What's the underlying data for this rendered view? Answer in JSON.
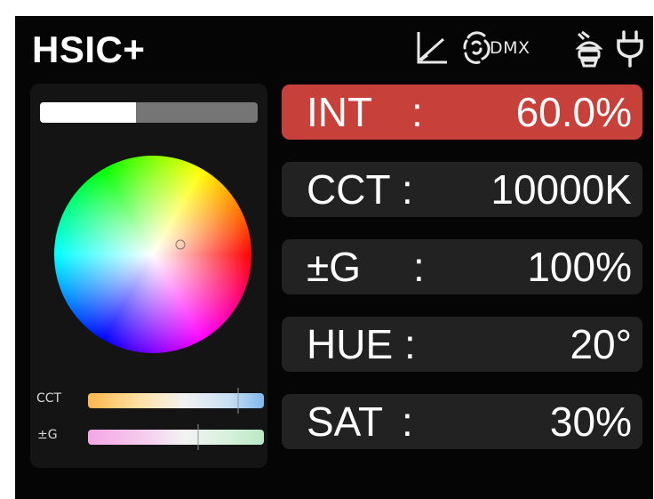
{
  "header": {
    "title": "HSIC+",
    "icons": [
      "curve-icon",
      "dmx-icon",
      "fan-icon",
      "power-plug-icon"
    ],
    "dmx_label": "DMX"
  },
  "intensity_bar": {
    "level": 0.44
  },
  "color_wheel": {
    "marker": {
      "hue_deg": 20,
      "saturation": 0.3
    }
  },
  "sliders": {
    "cct": {
      "label": "CCT",
      "level": 0.85
    },
    "g": {
      "label": "±G",
      "level": 0.62
    }
  },
  "params": [
    {
      "label": "INT",
      "sep": ":",
      "value": "60.0%",
      "active": true
    },
    {
      "label": "CCT",
      "sep": ":",
      "value": "10000K",
      "active": false
    },
    {
      "label": "±G",
      "sep": ":",
      "value": "100%",
      "active": false
    },
    {
      "label": "HUE",
      "sep": ":",
      "value": "20°",
      "active": false
    },
    {
      "label": "SAT",
      "sep": ":",
      "value": "30%",
      "active": false
    }
  ],
  "colors": {
    "active_row": "#c7403a",
    "row": "#222222",
    "background": "#050505"
  }
}
